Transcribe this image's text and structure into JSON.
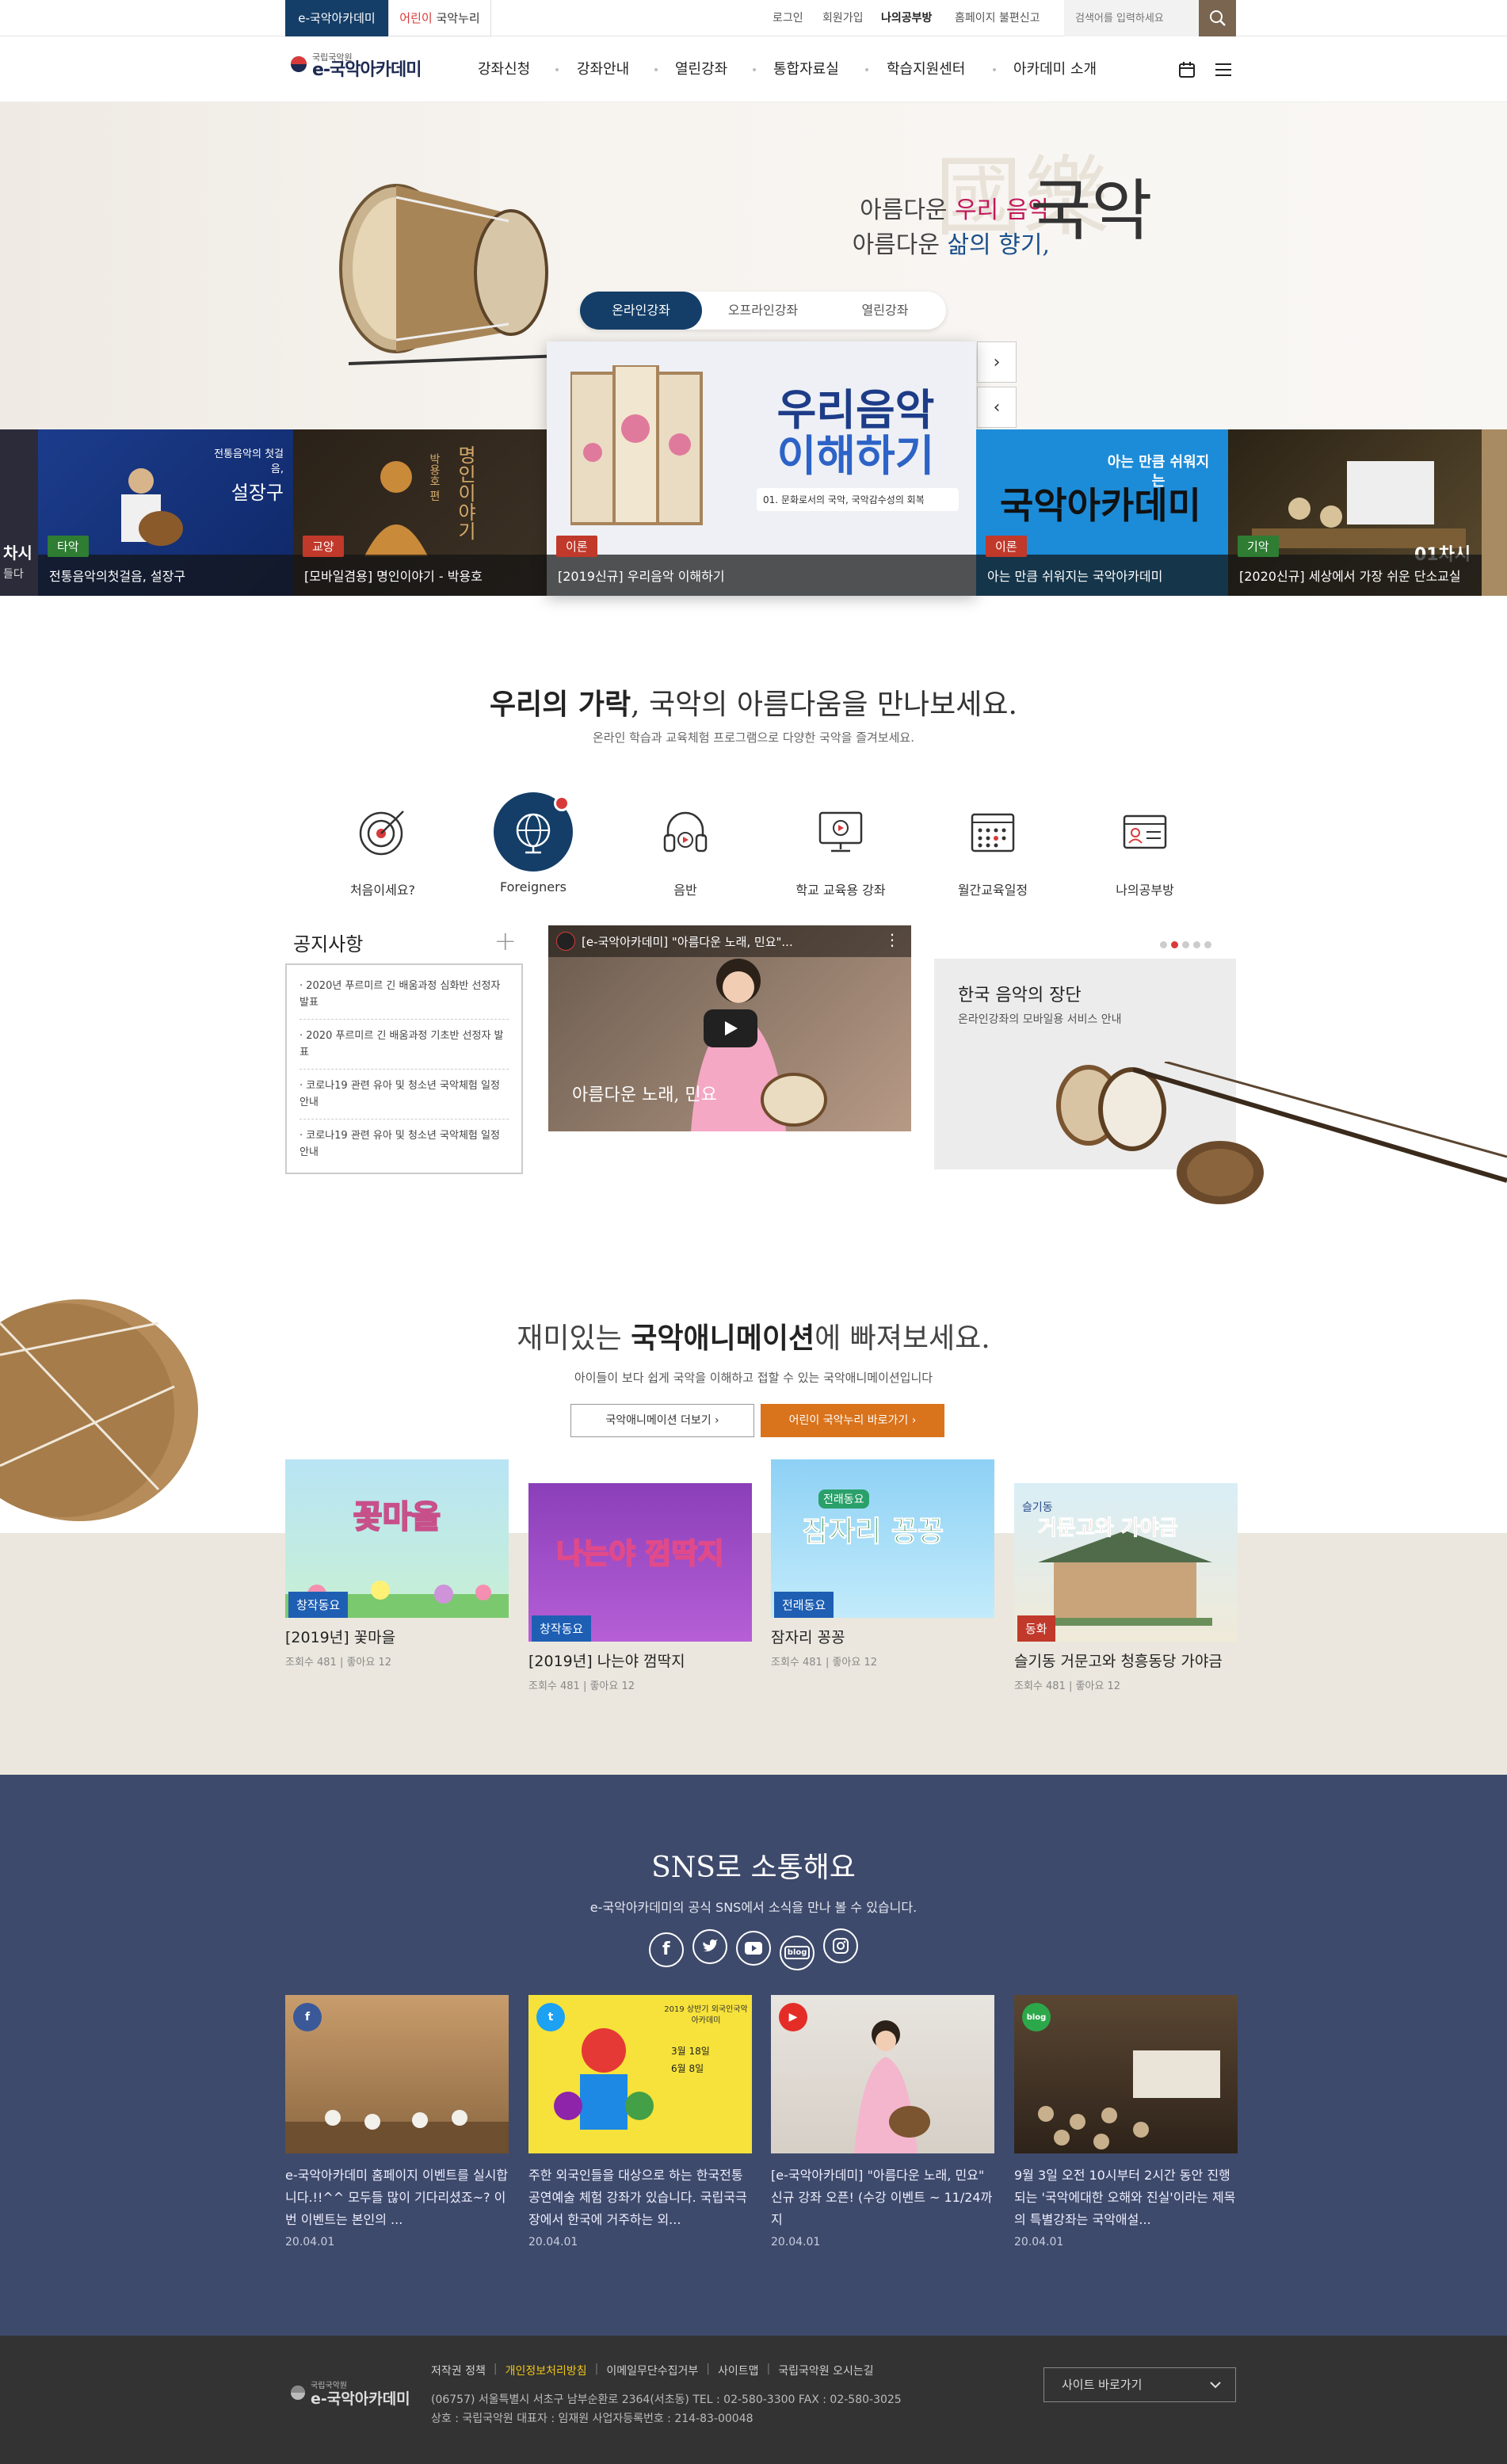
{
  "topbar": {
    "site1": "e-국악아카데미",
    "site2_prefix": "어린이",
    "site2_suffix": "국악누리",
    "login": "로그인",
    "join": "회원가입",
    "mystudy": "나의공부방",
    "report": "홈페이지 불편신고",
    "search_placeholder": "검색어를 입력하세요"
  },
  "header": {
    "logo_small": "국립국악원",
    "logo_big": "e-국악아카데미",
    "menu": [
      "강좌신청",
      "강좌안내",
      "열린강좌",
      "통합자료실",
      "학습지원센터",
      "아카데미 소개"
    ]
  },
  "hero": {
    "line1a": "아름다운 ",
    "line1b": "우리 음악",
    "line2a": "아름다운 ",
    "line2b": "삶의 향기,",
    "big": "국악",
    "hanja": "國樂",
    "tabs": [
      "온라인강좌",
      "오프라인강좌",
      "열린강좌"
    ],
    "center": {
      "title1": "우리음악",
      "title2": "이해하기",
      "sub": "01. 문화로서의 국악, 국악감수성의 회복"
    },
    "cards": [
      {
        "tag": "타악",
        "tagColor": "#2e7d32",
        "caption": "전통음악의첫걸음, 설장구",
        "art": "설장구",
        "artsub": "전통음악의 첫걸음,"
      },
      {
        "tag": "교양",
        "tagColor": "#c0392b",
        "caption": "[모바일겸용] 명인이야기 - 박용호",
        "art": "명인이야기",
        "artsub": "박용호 편"
      },
      {
        "tag": "이론",
        "tagColor": "#c0392b",
        "caption": "[2019신규] 우리음악 이해하기"
      },
      {
        "tag": "이론",
        "tagColor": "#c0392b",
        "caption": "아는 만큼 쉬워지는 국악아카데미",
        "art": "아는 만큼 쉬워지는",
        "artsub": "국악아카데미"
      },
      {
        "tag": "기악",
        "tagColor": "#2e7d32",
        "caption": "[2020신규] 세상에서 가장 쉬운 단소교실",
        "art": "01차시"
      }
    ],
    "edge_left": "차시",
    "edge_left2": "들다"
  },
  "intro": {
    "title_bold": "우리의 가락",
    "title_rest": ", 국악의 아름다움을 만나보세요.",
    "sub": "온라인 학습과 교육체험 프로그램으로 다양한 국악을 즐겨보세요.",
    "quick": [
      "처음이세요?",
      "Foreigners",
      "음반",
      "학교 교육용 강좌",
      "월간교육일정",
      "나의공부방"
    ]
  },
  "notice": {
    "title": "공지사항",
    "items": [
      "2020년 푸르미르 긴 배움과정 심화반 선정자 발표",
      "2020 푸르미르 긴 배움과정 기초반 선정자 발표",
      "코로나19 관련 유아 및 청소년 국악체험 일정 안내",
      "코로나19 관련 유아 및 청소년 국악체험 일정 안내"
    ]
  },
  "video": {
    "title": "[e-국악아카데미] \"아름다운 노래, 민요\"...",
    "caption": "아름다운 노래, 민요"
  },
  "promo": {
    "title": "한국 음악의 장단",
    "sub": "온라인강좌의 모바일용 서비스 안내"
  },
  "anim": {
    "title_a": "재미있는 ",
    "title_b": "국악애니메이션",
    "title_c": "에 빠져보세요.",
    "sub": "아이들이 보다 쉽게 국악을 이해하고 접할 수 있는 국악애니메이션입니다",
    "btn_more": "국악애니메이션 더보기",
    "btn_kids": "어린이 국악누리 바로가기",
    "items": [
      {
        "tag": "창작동요",
        "title": "[2019년] 꽃마을",
        "meta": "조회수 481  |  좋아요 12",
        "art": "꽃마을"
      },
      {
        "tag": "창작동요",
        "title": "[2019년] 나는야 껌딱지",
        "meta": "조회수 481  |  좋아요 12",
        "art": "나는야 껌딱지"
      },
      {
        "tag": "전래동요",
        "title": "잠자리 꽁꽁",
        "meta": "조회수 481  |  좋아요 12",
        "art": "잠자리 꽁꽁",
        "artsub": "전래동요"
      },
      {
        "tag": "동화",
        "title": "슬기동 거문고와 청흥동당 가야금",
        "meta": "조회수 481  |  좋아요 12",
        "art": "거문고와 가야금",
        "artsub": "슬기동"
      }
    ]
  },
  "sns": {
    "title": "SNS로 소통해요",
    "sub": "e-국악아카데미의 공식 SNS에서 소식을 만나 볼 수 있습니다.",
    "items": [
      {
        "type": "f",
        "color": "#3b5998",
        "text": "e-국악아카데미 홈페이지 이벤트를 실시합니다.!!^^ 모두들 많이 기다리셨죠~? 이번 이벤트는 본인의 ...",
        "date": "20.04.01"
      },
      {
        "type": "t",
        "color": "#1da1f2",
        "text": "주한 외국인들을 대상으로 하는 한국전통공연예술 체험 강좌가 있습니다. 국립국극장에서 한국에 거주하는 외...",
        "date": "20.04.01",
        "poster": "2019 상반기 외국인국악아카데미",
        "dates": "3월 18일\n6월 8일"
      },
      {
        "type": "y",
        "color": "#e52d27",
        "text": "[e-국악아카데미] \"아름다운 노래, 민요\" 신규 강좌 오픈! (수강 이벤트 ~ 11/24까지",
        "date": "20.04.01"
      },
      {
        "type": "b",
        "color": "#2ca84a",
        "text": "9월 3일 오전 10시부터 2시간 동안 진행되는 '국악에대한 오해와 진실'이라는 제목의 특별강좌는 국악애설...",
        "date": "20.04.01"
      }
    ]
  },
  "footer": {
    "links": [
      "저작권 정책",
      "개인정보처리방침",
      "이메일무단수집거부",
      "사이트맵",
      "국립국악원 오시는길"
    ],
    "address": "(06757) 서울특별시 서초구 남부순환로 2364(서초동) TEL : 02-580-3300 FAX : 02-580-3025",
    "info": "상호 : 국립국악원 대표자 : 임재원 사업자등록번호 : 214-83-00048",
    "select": "사이트 바로가기",
    "logo_small": "국립국악원",
    "logo_big": "e-국악아카데미"
  },
  "colors": {
    "navy": "#143e68",
    "brown": "#7a6551",
    "orange": "#d9731c",
    "snsbg": "#3e4a6b",
    "footer": "#333333",
    "red": "#d83a3a"
  }
}
